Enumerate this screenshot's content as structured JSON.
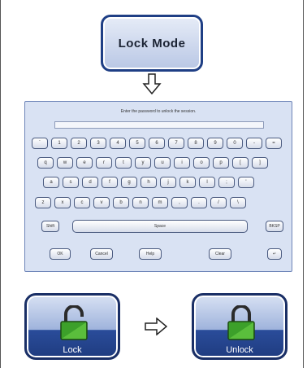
{
  "lock_mode_button": {
    "label": "Lock Mode"
  },
  "keyboard": {
    "prompt": "Enter the password to unlock the session.",
    "rows": [
      [
        "`",
        "1",
        "2",
        "3",
        "4",
        "5",
        "6",
        "7",
        "8",
        "9",
        "0",
        "-",
        "="
      ],
      [
        "q",
        "w",
        "e",
        "r",
        "t",
        "y",
        "u",
        "i",
        "o",
        "p",
        "[",
        "]"
      ],
      [
        "a",
        "s",
        "d",
        "f",
        "g",
        "h",
        "j",
        "k",
        "l",
        ";",
        "'"
      ],
      [
        "z",
        "x",
        "c",
        "v",
        "b",
        "n",
        "m",
        ",",
        ".",
        "/",
        "\\"
      ]
    ],
    "shift_label": "Shift",
    "space_label": "Space",
    "bksp_label": "BKSP",
    "ok_label": "OK",
    "cancel_label": "Cancel",
    "help_label": "Help",
    "clear_label": "Clear",
    "enter_label": "↵"
  },
  "lock_button": {
    "label": "Lock"
  },
  "unlock_button": {
    "label": "Unlock"
  },
  "colors": {
    "accent": "#1f3f85",
    "lock_green": "#3ca02a"
  },
  "icons": [
    "arrow-down-icon",
    "arrow-right-icon",
    "open-padlock-icon",
    "closed-padlock-icon"
  ]
}
